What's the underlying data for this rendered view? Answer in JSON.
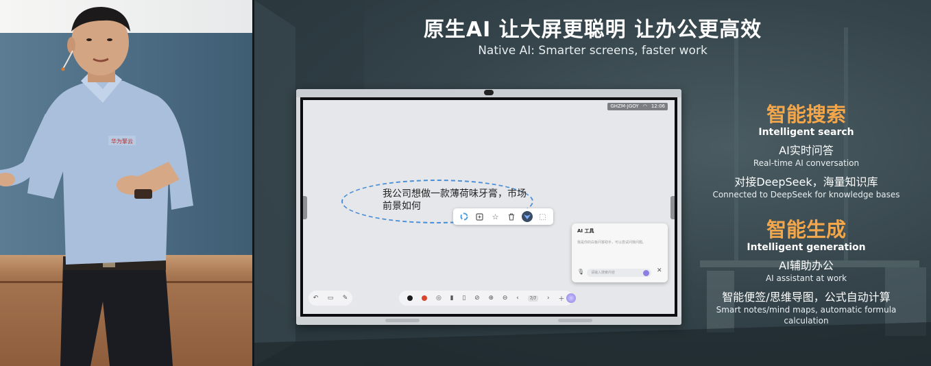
{
  "slide": {
    "title": "原生AI  让大屏更聪明  让办公更高效",
    "subtitle": "Native AI: Smarter screens, faster work"
  },
  "speaker": {
    "shirt_logo": "华为擎云"
  },
  "whiteboard": {
    "status": {
      "network": "GHZM-JGOY",
      "time": "12:06"
    },
    "prompt_text": "我公司想做一款薄荷味牙膏，市场前景如何",
    "ai_panel": {
      "title": "AI 工具",
      "hint": "我是你的白板问答助手，可以尝试问我问题。",
      "input_placeholder": "请输入搜索内容"
    },
    "page_indicator": "7/7"
  },
  "features": [
    {
      "heading_cn": "智能搜索",
      "heading_en": "Intelligent search",
      "items": [
        {
          "cn": "AI实时问答",
          "en": "Real-time AI conversation"
        },
        {
          "cn": "对接DeepSeek，海量知识库",
          "en": "Connected to DeepSeek for knowledge bases"
        }
      ]
    },
    {
      "heading_cn": "智能生成",
      "heading_en": "Intelligent generation",
      "items": [
        {
          "cn": "AI辅助办公",
          "en": "AI assistant at work"
        },
        {
          "cn": "智能便签/思维导图，公式自动计算",
          "en": "Smart notes/mind maps, automatic formula calculation"
        }
      ]
    }
  ],
  "colors": {
    "feature_heading": "#f3a64a",
    "mindmap_border": "#4b8fd6",
    "pen_red": "#d8442e",
    "pen_black": "#1b1b1b",
    "ai_accent": "#8a7fe0"
  },
  "icons": [
    "smart-ring-icon",
    "copy-icon",
    "star-icon",
    "trash-icon",
    "ai-assistant-icon",
    "mic-icon",
    "close-icon",
    "undo-icon",
    "folder-icon",
    "pen-icon",
    "plus-icon"
  ]
}
